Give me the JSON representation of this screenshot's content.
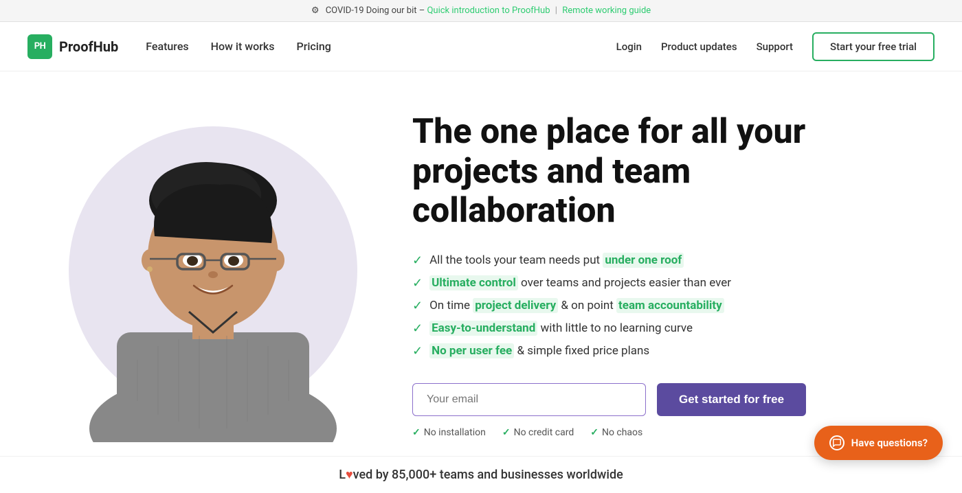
{
  "banner": {
    "prefix": "COVID-19 Doing our bit –",
    "link1_text": "Quick introduction to ProofHub",
    "link1_url": "#",
    "separator": "|",
    "link2_text": "Remote working guide",
    "link2_url": "#"
  },
  "nav": {
    "logo_initials": "PH",
    "logo_name": "ProofHub",
    "links": [
      {
        "label": "Features",
        "url": "#"
      },
      {
        "label": "How it works",
        "url": "#"
      },
      {
        "label": "Pricing",
        "url": "#"
      }
    ],
    "right_links": [
      {
        "label": "Login",
        "url": "#"
      },
      {
        "label": "Product updates",
        "url": "#"
      },
      {
        "label": "Support",
        "url": "#"
      }
    ],
    "cta_label": "Start your free trial"
  },
  "hero": {
    "title": "The one place for all your projects and team collaboration",
    "features": [
      {
        "text_before": "All the tools your team needs put",
        "highlight": "under one roof",
        "text_after": ""
      },
      {
        "text_before": "",
        "highlight": "Ultimate control",
        "text_after": " over teams and projects easier than ever"
      },
      {
        "text_before": "On time",
        "highlight": "project delivery",
        "text_middle": " & on point",
        "highlight2": "team accountability",
        "text_after": ""
      },
      {
        "text_before": "",
        "highlight": "Easy-to-understand",
        "text_after": " with little to no learning curve"
      },
      {
        "text_before": "",
        "highlight": "No per user fee",
        "text_after": " & simple fixed price plans"
      }
    ],
    "email_placeholder": "Your email",
    "cta_button": "Get started for free",
    "no_items": [
      "No installation",
      "No credit card",
      "No chaos"
    ]
  },
  "loved_bar": {
    "text_before": "L",
    "heart": "♥",
    "text_after": "ved by 85,000+ teams and businesses worldwide"
  },
  "chat": {
    "label": "Have questions?"
  }
}
